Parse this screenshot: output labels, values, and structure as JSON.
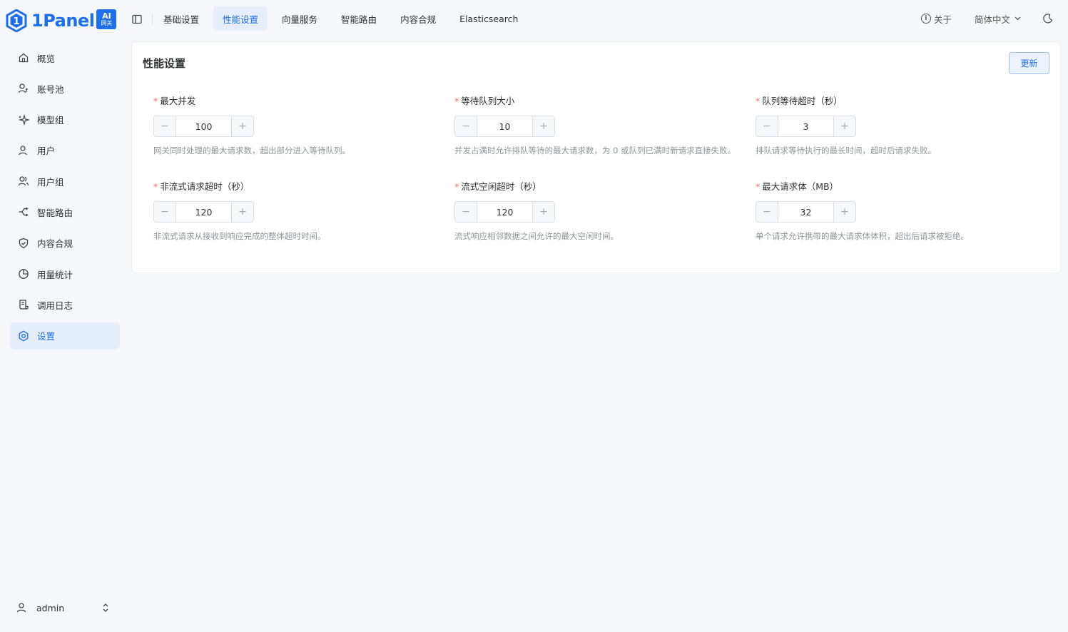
{
  "brand": {
    "name": "1Panel",
    "badge_line1": "AI",
    "badge_line2": "网关",
    "color": "#1f6fe6"
  },
  "header": {
    "tabs": [
      {
        "label": "基础设置",
        "active": false
      },
      {
        "label": "性能设置",
        "active": true
      },
      {
        "label": "向量服务",
        "active": false
      },
      {
        "label": "智能路由",
        "active": false
      },
      {
        "label": "内容合规",
        "active": false
      },
      {
        "label": "Elasticsearch",
        "active": false
      }
    ],
    "about_label": "关于",
    "language_label": "简体中文"
  },
  "sidebar": {
    "items": [
      {
        "label": "概览",
        "icon": "home-icon",
        "active": false
      },
      {
        "label": "账号池",
        "icon": "account-pool-icon",
        "active": false
      },
      {
        "label": "模型组",
        "icon": "sparkles-icon",
        "active": false
      },
      {
        "label": "用户",
        "icon": "user-icon",
        "active": false
      },
      {
        "label": "用户组",
        "icon": "users-icon",
        "active": false
      },
      {
        "label": "智能路由",
        "icon": "route-icon",
        "active": false
      },
      {
        "label": "内容合规",
        "icon": "shield-check-icon",
        "active": false
      },
      {
        "label": "用量统计",
        "icon": "pie-chart-icon",
        "active": false
      },
      {
        "label": "调用日志",
        "icon": "scroll-icon",
        "active": false
      },
      {
        "label": "设置",
        "icon": "gear-icon",
        "active": true
      }
    ],
    "user": {
      "name": "admin"
    }
  },
  "main": {
    "title": "性能设置",
    "update_label": "更新",
    "fields": [
      {
        "label": "最大并发",
        "value": "100",
        "help": "网关同时处理的最大请求数，超出部分进入等待队列。"
      },
      {
        "label": "等待队列大小",
        "value": "10",
        "help": "并发占满时允许排队等待的最大请求数，为 0 或队列已满时新请求直接失败。"
      },
      {
        "label": "队列等待超时（秒）",
        "value": "3",
        "help": "排队请求等待执行的最长时间，超时后请求失败。"
      },
      {
        "label": "非流式请求超时（秒）",
        "value": "120",
        "help": "非流式请求从接收到响应完成的整体超时时间。"
      },
      {
        "label": "流式空闲超时（秒）",
        "value": "120",
        "help": "流式响应相邻数据之间允许的最大空闲时间。"
      },
      {
        "label": "最大请求体（MB）",
        "value": "32",
        "help": "单个请求允许携带的最大请求体体积，超出后请求被拒绝。"
      }
    ],
    "required_mark": "*",
    "minus_symbol": "−",
    "plus_symbol": "+"
  }
}
